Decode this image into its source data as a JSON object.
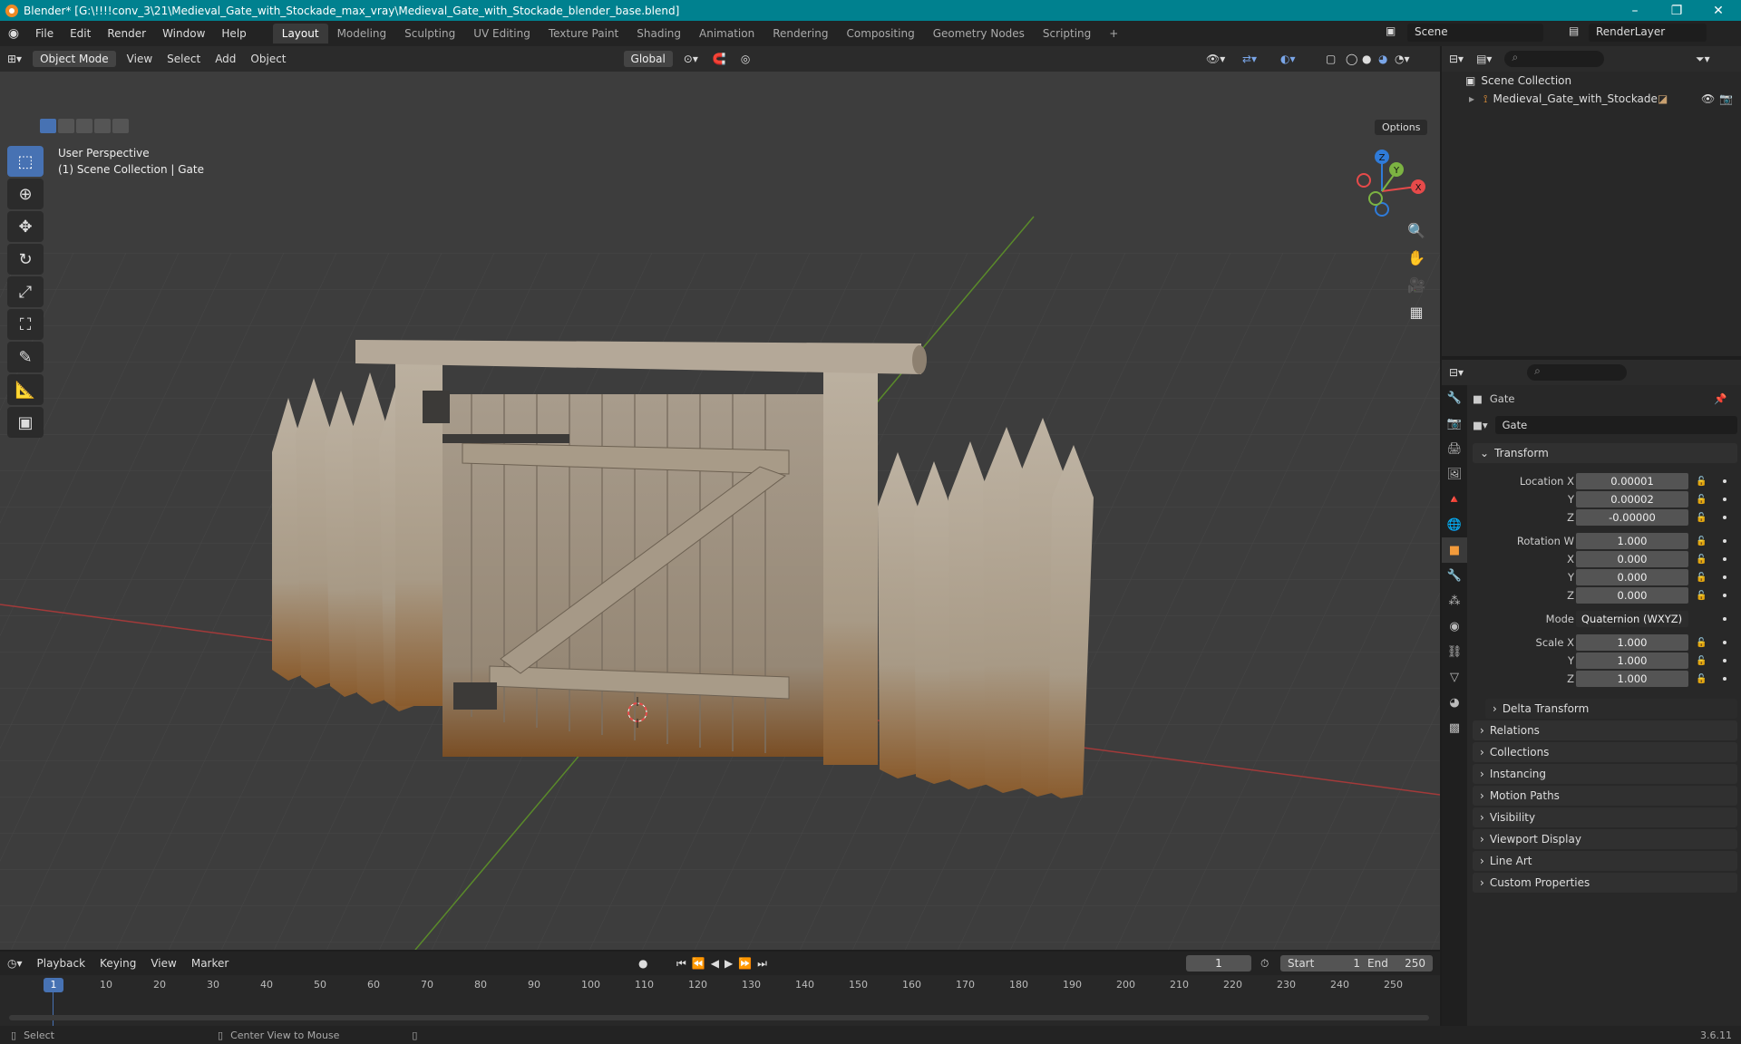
{
  "titlebar": {
    "text": "Blender* [G:\\!!!!conv_3\\21\\Medieval_Gate_with_Stockade_max_vray\\Medieval_Gate_with_Stockade_blender_base.blend]"
  },
  "menu": [
    "File",
    "Edit",
    "Render",
    "Window",
    "Help"
  ],
  "workspaces": [
    "Layout",
    "Modeling",
    "Sculpting",
    "UV Editing",
    "Texture Paint",
    "Shading",
    "Animation",
    "Rendering",
    "Compositing",
    "Geometry Nodes",
    "Scripting"
  ],
  "scene": {
    "label": "Scene",
    "render_layer": "RenderLayer"
  },
  "viewport": {
    "mode": "Object Mode",
    "menus": [
      "View",
      "Select",
      "Add",
      "Object"
    ],
    "orientation": "Global",
    "options": "Options",
    "overlay_line1": "User Perspective",
    "overlay_line2": "(1) Scene Collection | Gate",
    "gizmo": {
      "x": "X",
      "y": "Y",
      "z": "Z"
    }
  },
  "outliner": {
    "root": "Scene Collection",
    "items": [
      "Medieval_Gate_with_Stockade"
    ]
  },
  "properties": {
    "object_name": "Gate",
    "data_name": "Gate",
    "transform_label": "Transform",
    "location": {
      "label": "Location X",
      "x": "0.00001",
      "y": "0.00002",
      "z": "-0.00000"
    },
    "rotation": {
      "label": "Rotation W",
      "w": "1.000",
      "x": "0.000",
      "y": "0.000",
      "z": "0.000"
    },
    "mode": {
      "label": "Mode",
      "value": "Quaternion (WXYZ)"
    },
    "scale": {
      "label": "Scale X",
      "x": "1.000",
      "y": "1.000",
      "z": "1.000"
    },
    "axis_labels": {
      "x": "X",
      "y": "Y",
      "z": "Z"
    },
    "sections": [
      "Delta Transform",
      "Relations",
      "Collections",
      "Instancing",
      "Motion Paths",
      "Visibility",
      "Viewport Display",
      "Line Art",
      "Custom Properties"
    ]
  },
  "timeline": {
    "menus": [
      "Playback",
      "Keying",
      "View",
      "Marker"
    ],
    "current_frame": "1",
    "start_label": "Start",
    "start": "1",
    "end_label": "End",
    "end": "250",
    "ticks": [
      "1",
      "10",
      "20",
      "30",
      "40",
      "50",
      "60",
      "70",
      "80",
      "90",
      "100",
      "110",
      "120",
      "130",
      "140",
      "150",
      "160",
      "170",
      "180",
      "190",
      "200",
      "210",
      "220",
      "230",
      "240",
      "250"
    ]
  },
  "statusbar": {
    "select": "Select",
    "center": "Center View to Mouse",
    "version": "3.6.11"
  },
  "colors": {
    "accent": "#4772b3",
    "titlebar": "#00818f",
    "x_axis": "#e64a4a",
    "y_axis": "#7cb342",
    "z_axis": "#2f7bd9"
  }
}
